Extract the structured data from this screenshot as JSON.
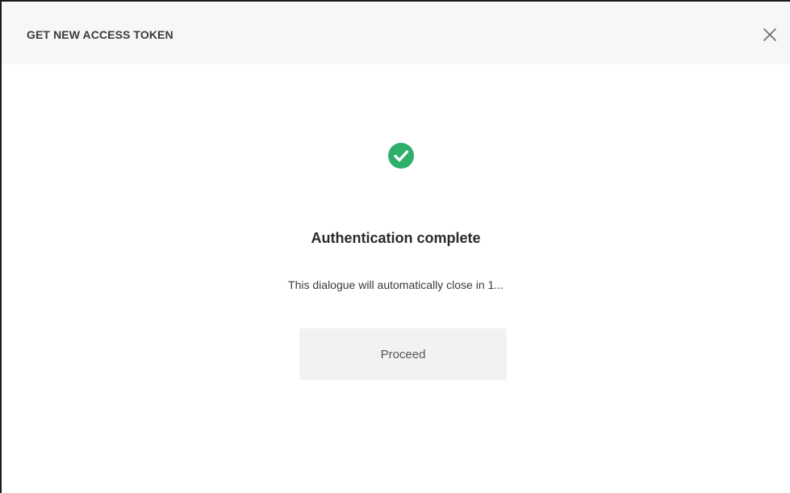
{
  "dialog": {
    "title": "GET NEW ACCESS TOKEN",
    "close_icon": "close-icon",
    "status_icon": "check-circle-icon",
    "headline": "Authentication complete",
    "message": "This dialogue will automatically close in 1...",
    "proceed_label": "Proceed"
  },
  "colors": {
    "success": "#2eaf6b",
    "header_background": "#f7f7f7",
    "button_background": "#f2f2f2"
  }
}
